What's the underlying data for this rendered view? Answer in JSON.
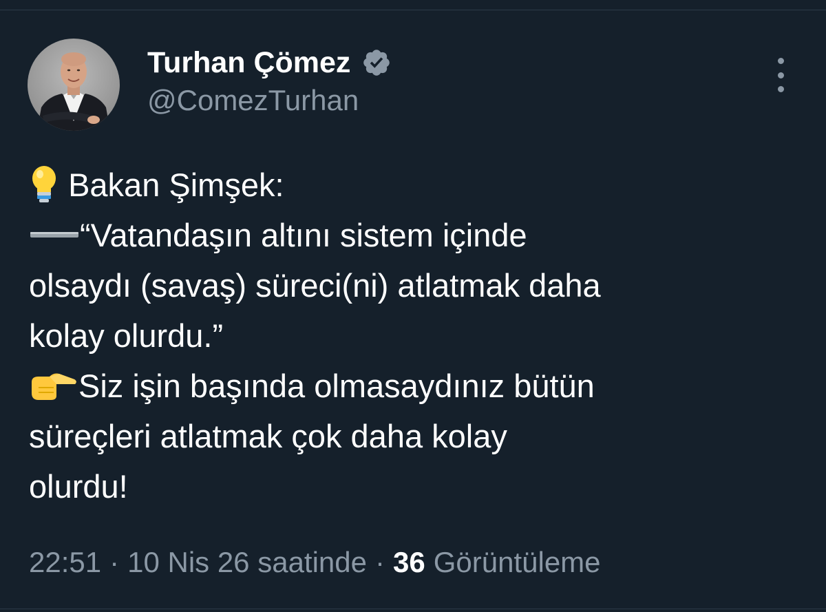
{
  "author": {
    "name": "Turhan Çömez",
    "handle": "@ComezTurhan",
    "verified": true,
    "avatar": "profile-photo"
  },
  "menu": {
    "icon": "more-vertical-icon"
  },
  "tweet": {
    "lines": [
      {
        "emoji": "light-bulb-icon",
        "text": "Bakan Şimşek:"
      },
      {
        "emoji": "dash-icon",
        "text": "“Vatandaşın altını sistem içinde"
      },
      {
        "text": "olsaydı (savaş) süreci(ni) atlatmak daha"
      },
      {
        "text": "kolay olurdu.”"
      },
      {
        "emoji": "pointing-right-icon",
        "text": "Siz işin başında olmasaydınız bütün"
      },
      {
        "text": "süreçleri atlatmak çok daha kolay"
      },
      {
        "text": "olurdu!"
      }
    ]
  },
  "meta": {
    "time": "22:51",
    "separator": "·",
    "date": "10 Nis 26 saatinde",
    "views_count": "36",
    "views_label": "Görüntüleme"
  },
  "colors": {
    "background": "#15202b",
    "text": "#ffffff",
    "secondary": "#8b98a5",
    "verified": "#8b98a5"
  }
}
